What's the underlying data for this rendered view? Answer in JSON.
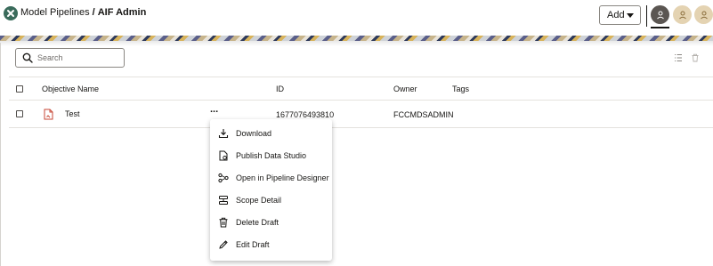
{
  "breadcrumb": {
    "root": "Model Pipelines",
    "separator": "/",
    "current": "AIF Admin"
  },
  "header": {
    "add_label": "Add",
    "logo_icon": "close-x-icon",
    "brand_color": "#3a6b5b"
  },
  "avatars": [
    "person-icon",
    "person-icon",
    "person-icon"
  ],
  "search": {
    "placeholder": "Search",
    "value": ""
  },
  "toolbar": {
    "icons": [
      "list-view-icon",
      "trash-icon"
    ]
  },
  "table": {
    "columns": [
      "Objective Name",
      "ID",
      "Owner",
      "Tags"
    ],
    "rows": [
      {
        "name": "Test",
        "id": "1677076493810",
        "owner": "FCCMDSADMIN",
        "tags": ""
      }
    ]
  },
  "row_actions_icon": "...",
  "context_menu": {
    "items": [
      {
        "label": "Download",
        "icon": "download-icon"
      },
      {
        "label": "Publish Data Studio",
        "icon": "publish-document-icon"
      },
      {
        "label": "Open in Pipeline Designer",
        "icon": "pipeline-icon"
      },
      {
        "label": "Scope Detail",
        "icon": "scope-icon"
      },
      {
        "label": "Delete Draft",
        "icon": "trash-icon"
      },
      {
        "label": "Edit Draft",
        "icon": "pencil-icon"
      }
    ]
  }
}
